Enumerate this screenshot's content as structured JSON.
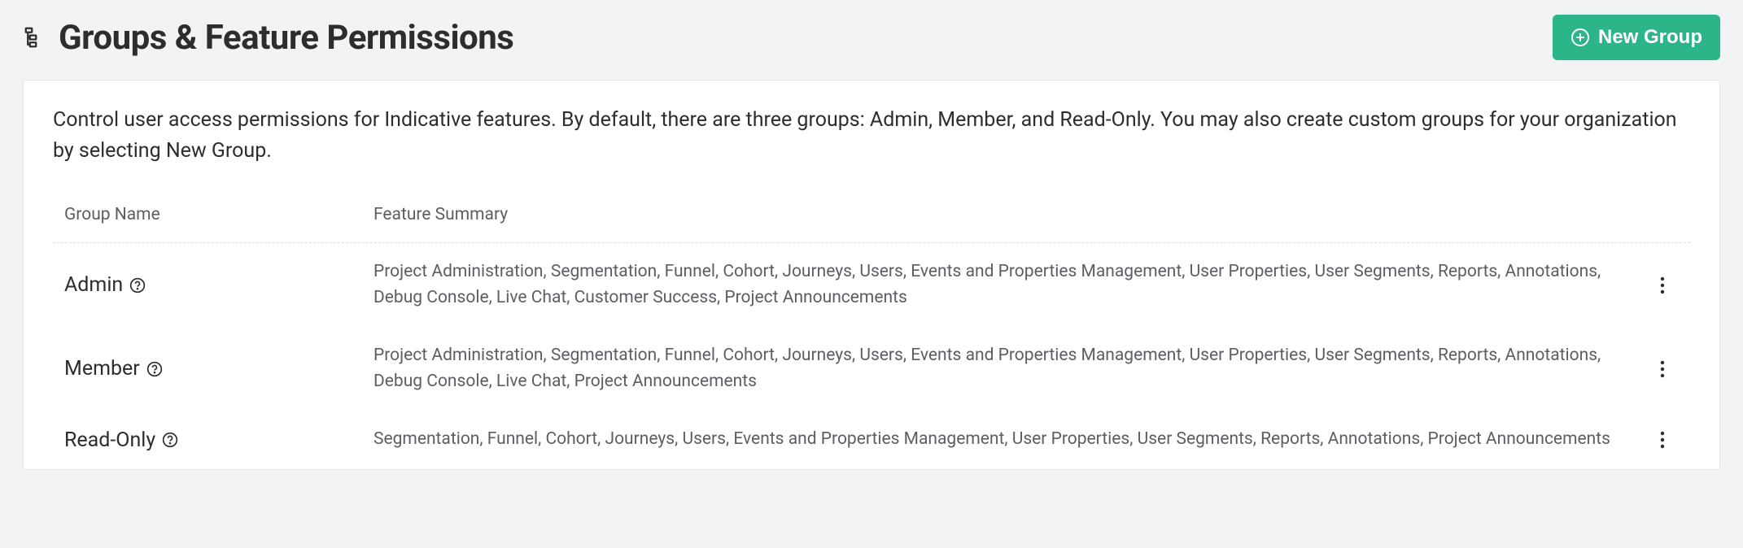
{
  "header": {
    "title": "Groups & Feature Permissions",
    "new_group_label": "New Group"
  },
  "card": {
    "description": "Control user access permissions for Indicative features. By default, there are three groups: Admin, Member, and Read-Only. You may also create custom groups for your organization by selecting New Group."
  },
  "table": {
    "columns": {
      "name": "Group Name",
      "summary": "Feature Summary"
    },
    "rows": [
      {
        "name": "Admin",
        "summary": "Project Administration, Segmentation, Funnel, Cohort, Journeys, Users, Events and Properties Management, User Properties, User Segments, Reports, Annotations, Debug Console, Live Chat, Customer Success, Project Announcements"
      },
      {
        "name": "Member",
        "summary": "Project Administration, Segmentation, Funnel, Cohort, Journeys, Users, Events and Properties Management, User Properties, User Segments, Reports, Annotations, Debug Console, Live Chat, Project Announcements"
      },
      {
        "name": "Read-Only",
        "summary": "Segmentation, Funnel, Cohort, Journeys, Users, Events and Properties Management, User Properties, User Segments, Reports, Annotations, Project Announcements"
      }
    ]
  }
}
